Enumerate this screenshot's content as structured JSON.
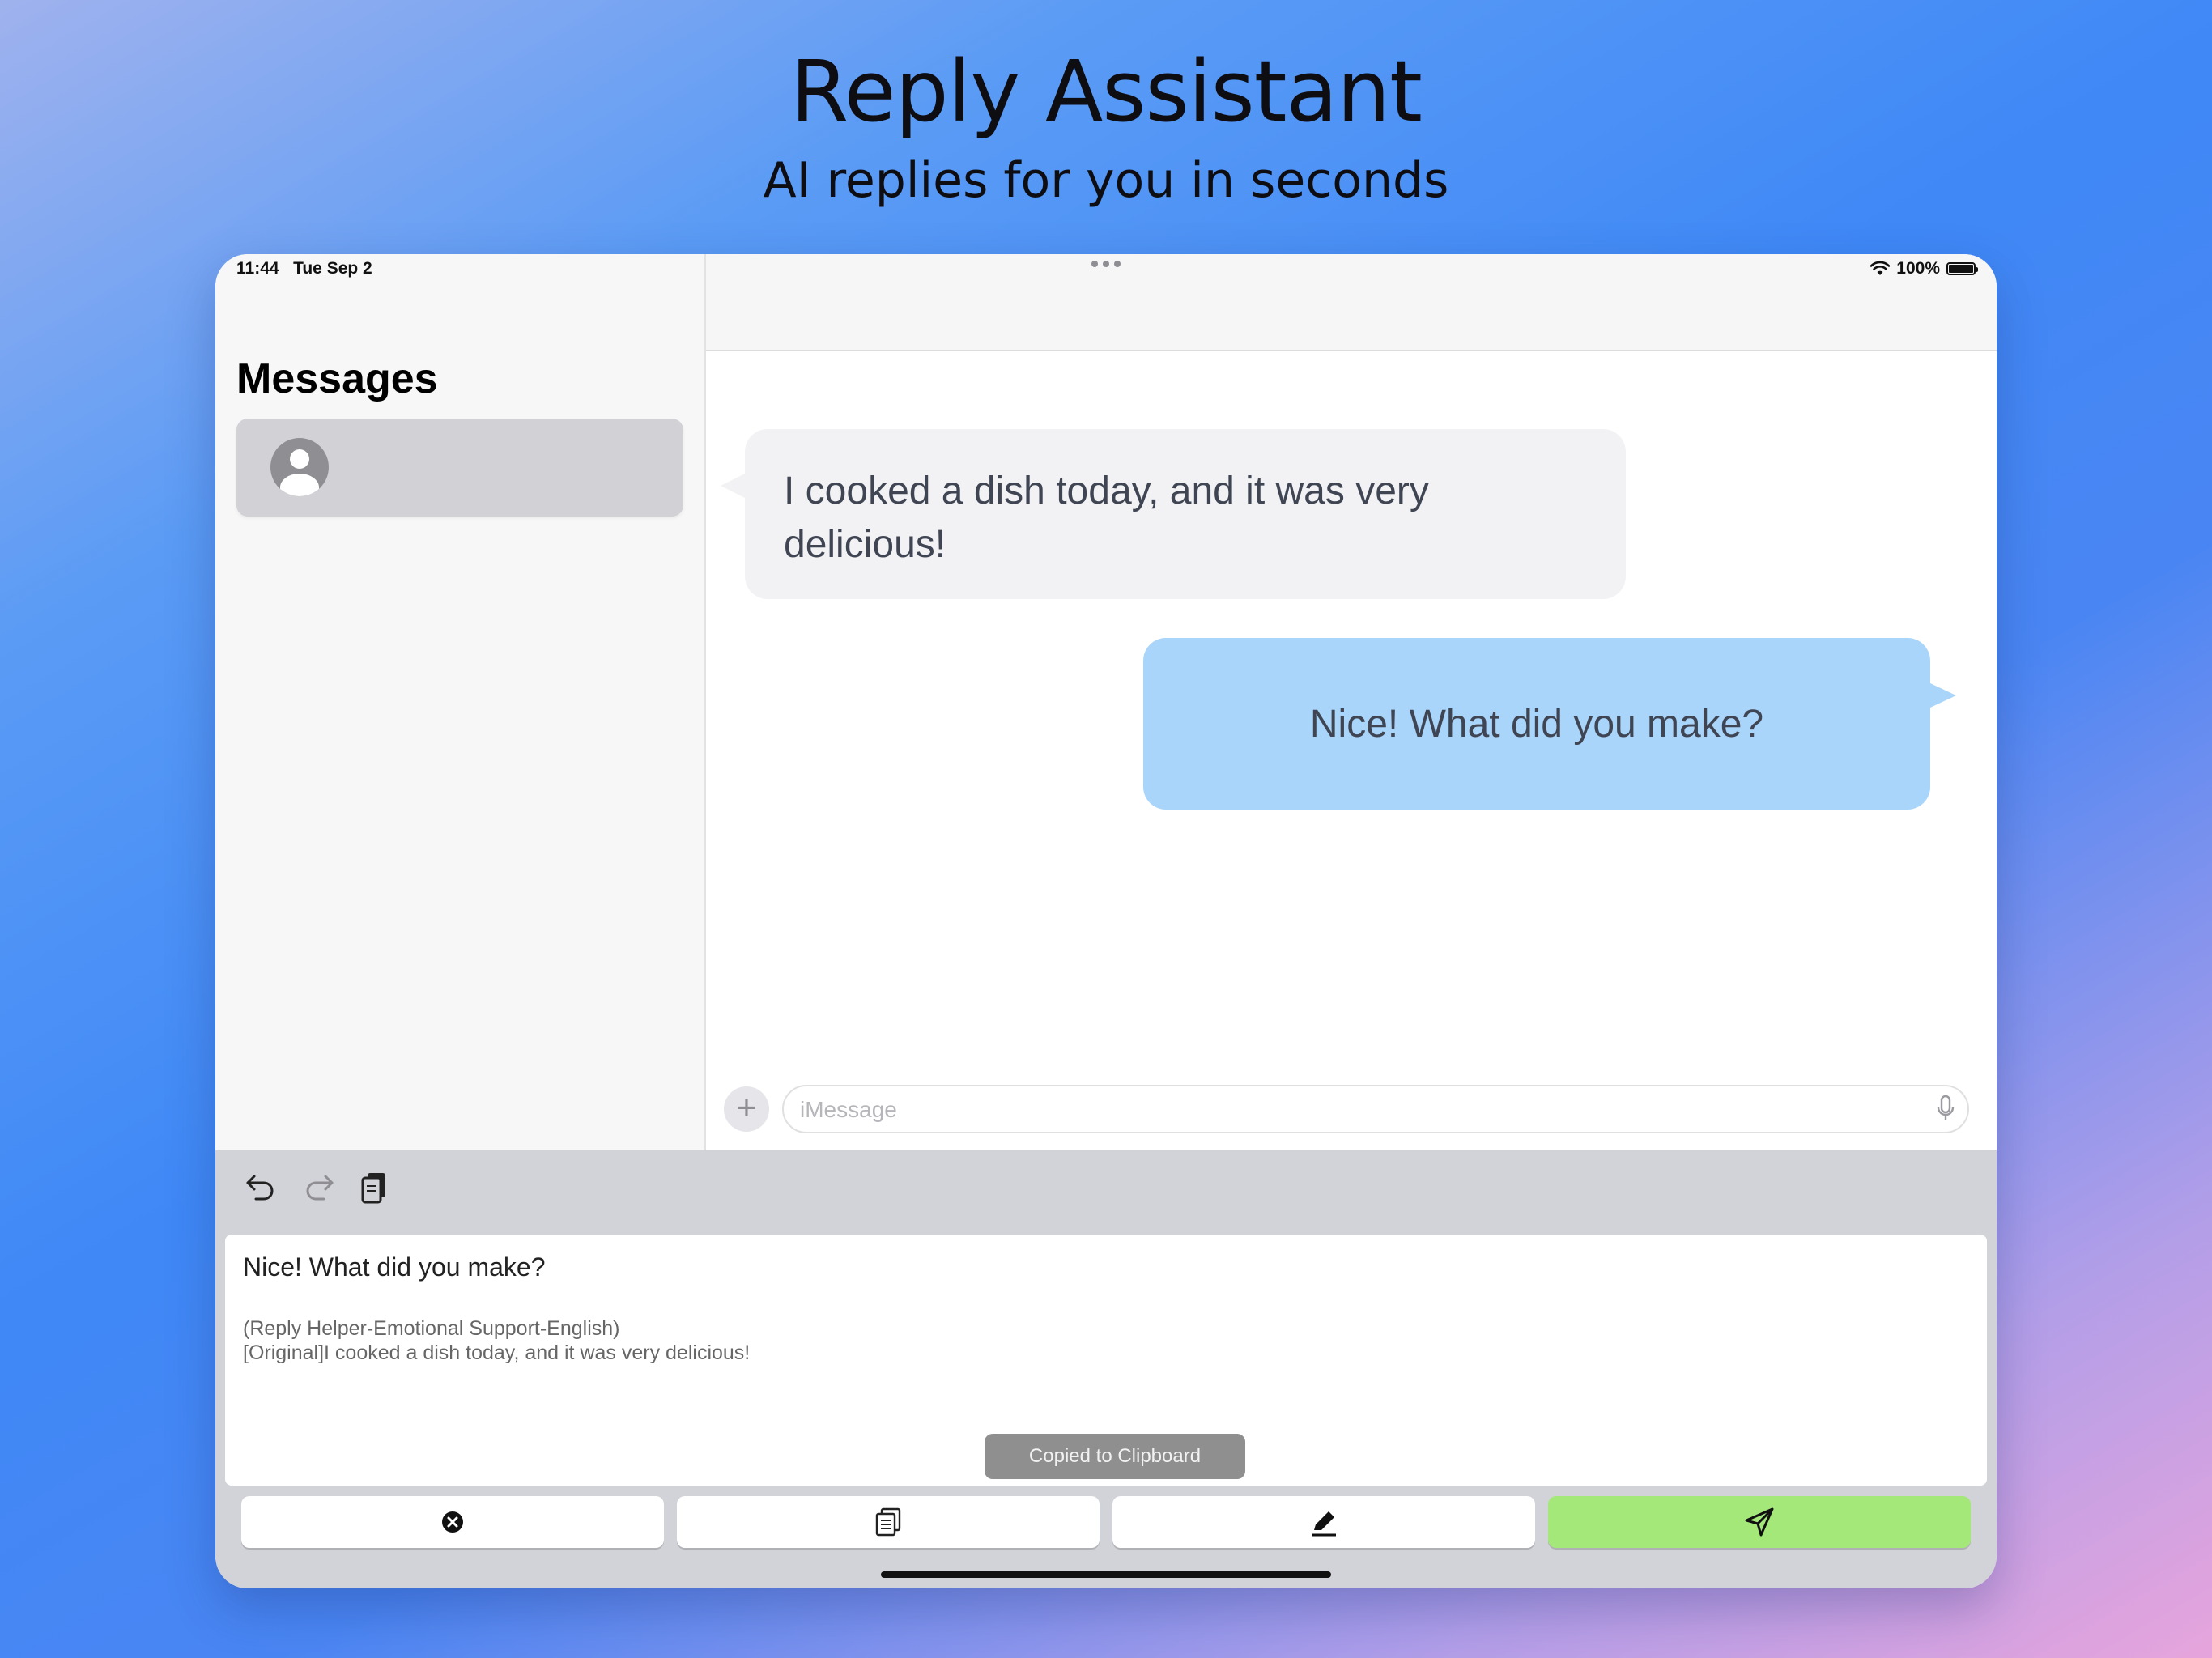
{
  "hero": {
    "title": "Reply Assistant",
    "subtitle": "AI replies for you in seconds"
  },
  "status_bar": {
    "time": "11:44",
    "date": "Tue Sep 2",
    "battery": "100%",
    "icons": [
      "wifi-icon",
      "battery-icon"
    ]
  },
  "sidebar": {
    "title": "Messages",
    "conversations": [
      {
        "avatar": "person-icon",
        "name": ""
      }
    ]
  },
  "chat": {
    "incoming": {
      "text": "I cooked a dish today, and it was very delicious!"
    },
    "outgoing": {
      "text": "Nice! What did you make?"
    },
    "input": {
      "placeholder": "iMessage",
      "value": ""
    }
  },
  "keyboard_panel": {
    "toolbar": [
      "undo-icon",
      "redo-icon",
      "paste-icon"
    ],
    "editor": {
      "reply": "Nice! What did you make?",
      "meta_1": "(Reply Helper-Emotional Support-English)",
      "meta_2": "[Original]I cooked a dish today, and it was very delicious!"
    },
    "toast": "Copied to Clipboard",
    "actions": [
      "clear-icon",
      "copy-icon",
      "edit-icon",
      "send-icon"
    ],
    "colors": {
      "send_button": "#a5e87a",
      "panel": "#d2d3d8"
    }
  },
  "colors": {
    "incoming_bubble": "#f2f2f4",
    "outgoing_bubble": "#a9d5fb"
  }
}
